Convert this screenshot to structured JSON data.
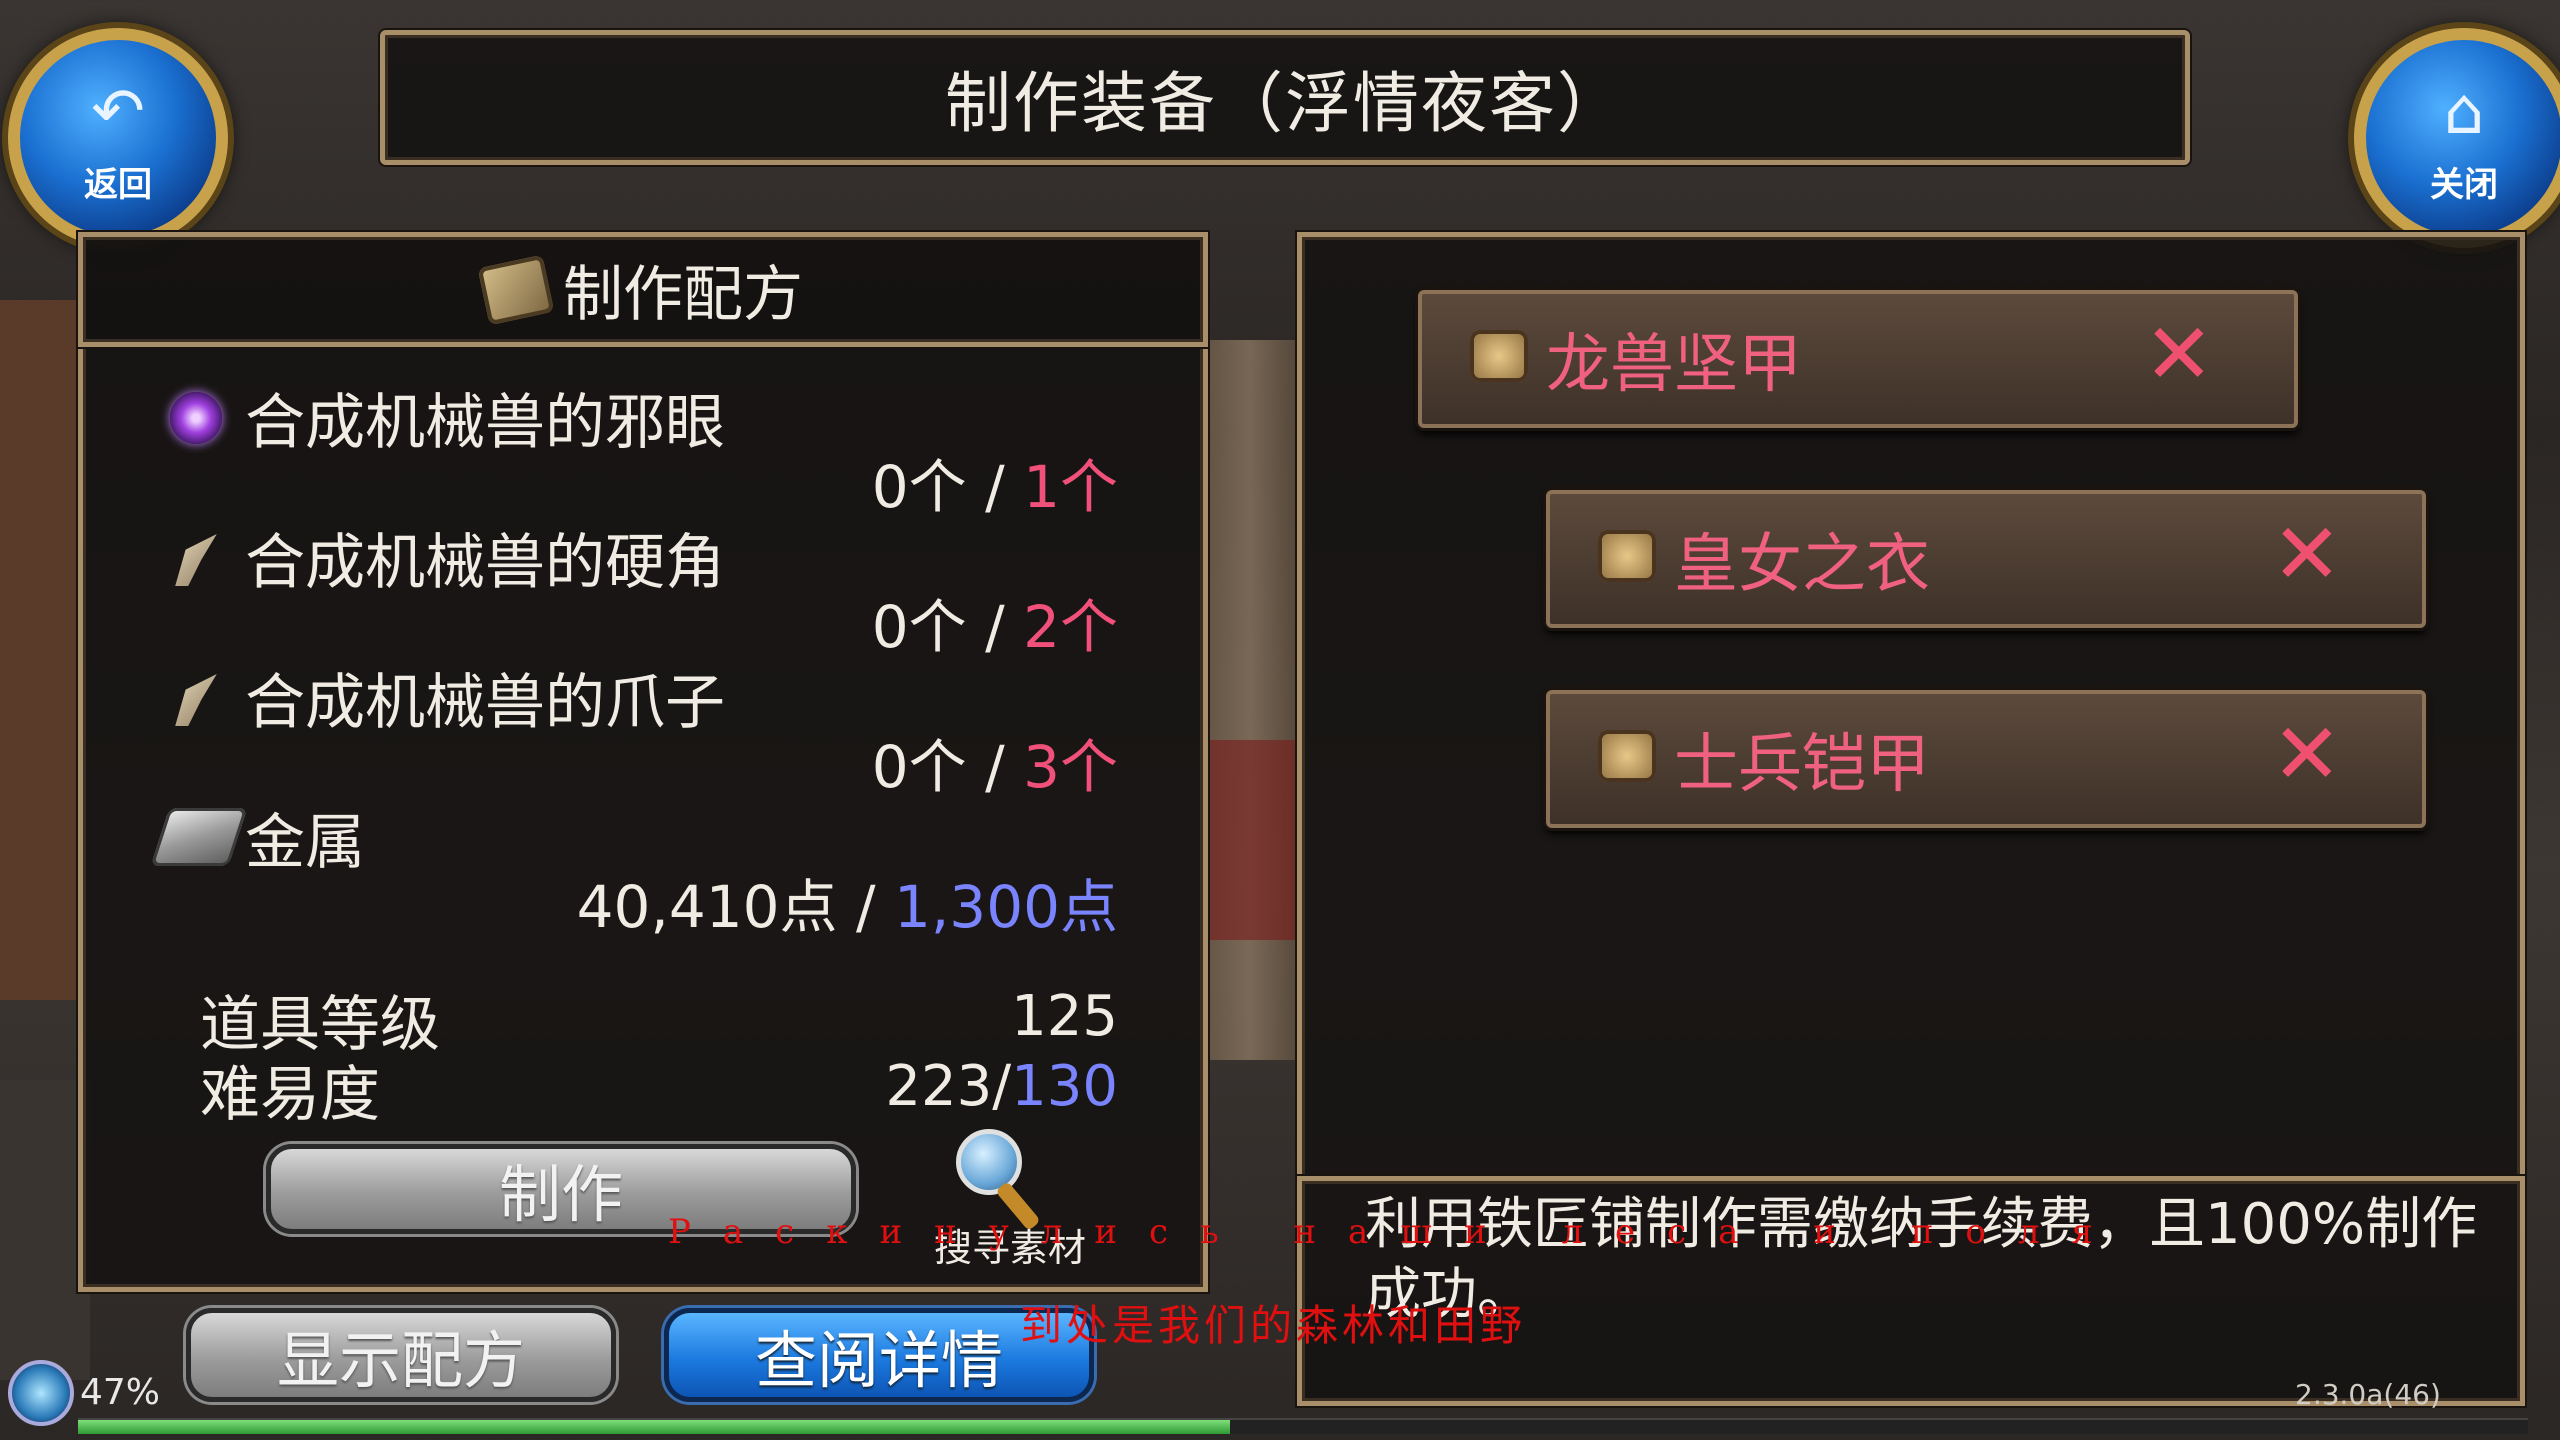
{
  "title": "制作装备（浮情夜客）",
  "back_button": {
    "label": "返回",
    "icon": "return-arrow-icon"
  },
  "close_button": {
    "label": "关闭",
    "icon": "home-icon"
  },
  "recipe_panel": {
    "header": "制作配方",
    "materials": [
      {
        "name": "合成机械兽的邪眼",
        "have": "0个",
        "separator": " / ",
        "need": "1个",
        "icon": "eye-orb-icon",
        "need_color": "red"
      },
      {
        "name": "合成机械兽的硬角",
        "have": "0个",
        "separator": " / ",
        "need": "2个",
        "icon": "horn-icon",
        "need_color": "red"
      },
      {
        "name": "合成机械兽的爪子",
        "have": "0个",
        "separator": " / ",
        "need": "3个",
        "icon": "claw-icon",
        "need_color": "red"
      },
      {
        "name": "金属",
        "have": "40,410点",
        "separator": " / ",
        "need": "1,300点",
        "icon": "metal-ingot-icon",
        "need_color": "blue"
      }
    ],
    "item_level_label": "道具等级",
    "item_level_value": "125",
    "difficulty_label": "难易度",
    "difficulty_value": "223",
    "difficulty_sep": "/",
    "difficulty_max": "130",
    "craft_button": "制作",
    "search_label": "搜寻素材"
  },
  "equipment_list": [
    {
      "name": "龙兽坚甲",
      "remove": "✕"
    },
    {
      "name": "皇女之衣",
      "remove": "✕"
    },
    {
      "name": "士兵铠甲",
      "remove": "✕"
    }
  ],
  "message": "利用铁匠铺制作需缴纳手续费，且100%制作成功。",
  "show_recipe_button": "显示配方",
  "view_details_button": "查阅详情",
  "version": "2.3.0a(46)",
  "loading_percent": "47%",
  "loading_progress": 0.47,
  "overlay_text_ru": "Раскинулись наши леса и поля",
  "overlay_text_zh": "到处是我们的森林和田野",
  "colors": {
    "accent_red": "#f0507a",
    "accent_blue": "#7a84ff",
    "item_name": "#f06080",
    "frame_gold": "#a88f6a"
  }
}
